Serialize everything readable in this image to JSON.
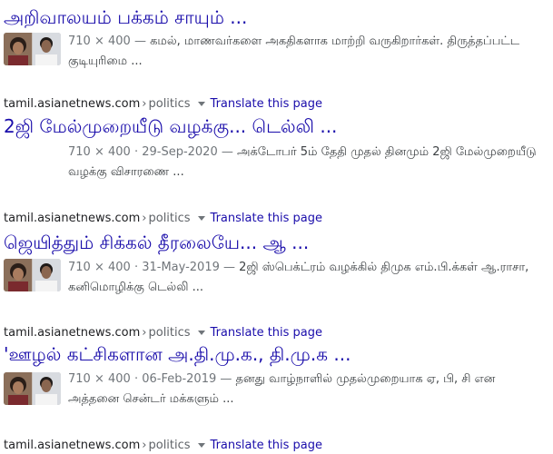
{
  "results": [
    {
      "title": "அறிவாலயம் பக்கம் சாயும் ...",
      "dims": "710 × 400",
      "date": "",
      "text": "கமல், மாணவர்களை அகதிகளாக மாற்றி வருகிறார்கள். திருத்தப்பட்ட குடியுரிமை ..."
    },
    {
      "source": {
        "domain": "tamil.asianetnews.com",
        "path": "politics",
        "translate": "Translate this page"
      },
      "title": "2ஜி மேல்முறையீடு வழக்கு... டெல்லி ...",
      "dims": "710 × 400",
      "date": "29-Sep-2020",
      "text": "அக்டோபர் 5ம் தேதி முதல் தினமும் 2ஜி மேல்முறையீடு வழக்கு விசாரணை ..."
    },
    {
      "source": {
        "domain": "tamil.asianetnews.com",
        "path": "politics",
        "translate": "Translate this page"
      },
      "title": "ஜெயித்தும் சிக்கல் தீரலையே... ஆ ...",
      "dims": "710 × 400",
      "date": "31-May-2019",
      "text": "2ஜி ஸ்பெக்ட்ரம் வழக்கில் திமுக எம்.பி.க்கள் ஆ.ராசா, கனிமொழிக்கு டெல்லி ..."
    },
    {
      "source": {
        "domain": "tamil.asianetnews.com",
        "path": "politics",
        "translate": "Translate this page"
      },
      "title": "'ஊழல் கட்சிகளான அ.தி.மு.க., தி.மு.க ...",
      "dims": "710 × 400",
      "date": "06-Feb-2019",
      "text": "தனது வாழ்நாளில் முதல்முறையாக ஏ, பி, சி என அத்தனை சென்டர் மக்களும் ..."
    }
  ],
  "trailing_source": {
    "domain": "tamil.asianetnews.com",
    "path": "politics",
    "translate": "Translate this page"
  },
  "meta_separator": "·",
  "dash": "—",
  "breadcrumb_sep": "›",
  "colors": {
    "title_link": "#1a0dab",
    "snippet_text": "#3c4043",
    "meta_text": "#70757a",
    "domain_text": "#202124"
  },
  "icons": {
    "dropdown": "triangle-down-icon",
    "thumbnail": "news-thumbnail-image"
  }
}
